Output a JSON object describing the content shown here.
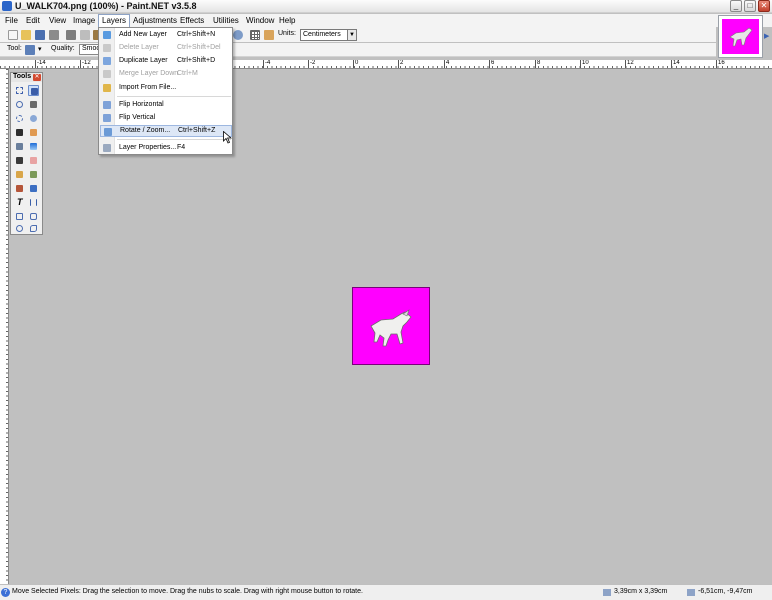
{
  "window": {
    "title": "U_WALK704.png (100%) - Paint.NET v3.5.8"
  },
  "menubar": [
    "File",
    "Edit",
    "View",
    "Image",
    "Layers",
    "Adjustments",
    "Effects",
    "Utilities",
    "Window",
    "Help"
  ],
  "toolbar": {
    "units_label": "Units:",
    "units_value": "Centimeters",
    "tool_label": "Tool:",
    "quality_label": "Quality:",
    "quality_value": "Smoot"
  },
  "ruler_ticks": [
    "-14",
    "-12",
    "-4",
    "-2",
    "0",
    "2",
    "4",
    "6",
    "8",
    "10",
    "12",
    "14",
    "16"
  ],
  "tools_window": {
    "title": "Tools"
  },
  "layers_menu": {
    "items": [
      {
        "label": "Add New Layer",
        "shortcut": "Ctrl+Shift+N",
        "enabled": true,
        "icon_color": "#5a9be0"
      },
      {
        "label": "Delete Layer",
        "shortcut": "Ctrl+Shift+Del",
        "enabled": false,
        "icon_color": "#c9c9c9"
      },
      {
        "label": "Duplicate Layer",
        "shortcut": "Ctrl+Shift+D",
        "enabled": true,
        "icon_color": "#7da6de"
      },
      {
        "label": "Merge Layer Down",
        "shortcut": "Ctrl+M",
        "enabled": false,
        "icon_color": "#c9c9c9"
      },
      {
        "label": "Import From File...",
        "shortcut": "",
        "enabled": true,
        "icon_color": "#e0b64a"
      },
      {
        "label": "Flip Horizontal",
        "shortcut": "",
        "enabled": true,
        "icon_color": "#7ea2d8"
      },
      {
        "label": "Flip Vertical",
        "shortcut": "",
        "enabled": true,
        "icon_color": "#7ea2d8"
      },
      {
        "label": "Rotate / Zoom...",
        "shortcut": "Ctrl+Shift+Z",
        "enabled": true,
        "icon_color": "#6b9ad6"
      },
      {
        "label": "Layer Properties...",
        "shortcut": "F4",
        "enabled": true,
        "icon_color": "#9aa9bf"
      }
    ]
  },
  "status": {
    "message": "Move Selected Pixels: Drag the selection to move. Drag the nubs to scale. Drag with right mouse button to rotate.",
    "size": "3,39cm x 3,39cm",
    "position": "-6,51cm, -9,47cm"
  },
  "colors": {
    "image_bg": "#ff00ff",
    "workspace": "#c0c0c0"
  }
}
